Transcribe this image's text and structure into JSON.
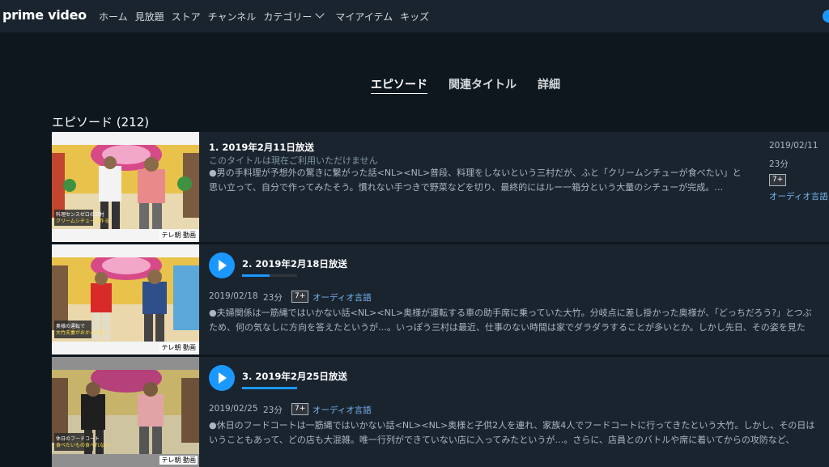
{
  "header": {
    "logo": "prime video",
    "nav": [
      "ホーム",
      "見放題",
      "ストア",
      "チャンネル",
      "カテゴリー",
      "マイアイテム",
      "キッズ"
    ]
  },
  "tabs": [
    "エピソード",
    "関連タイトル",
    "詳細"
  ],
  "section_title": "エピソード (212)",
  "episodes": [
    {
      "title": "1. 2019年2月11日放送",
      "unavailable": "このタイトルは現在ご利用いただけません",
      "desc1": "●男の手料理が予想外の驚きに繋がった話<NL><NL>普段、料理をしないという三村だが、ふと「クリームシチューが食べたい」と",
      "desc2": "思い立って、自分で作ってみたそう。慣れない手つきで野菜などを切り、最終的にはルー一箱分という大量のシチューが完成。…",
      "date": "2019/02/11",
      "duration": "23分",
      "rating": "7+",
      "audio": "オーディオ言語",
      "thumb_caption": "料理センスゼロの三村 クリームシチューを作る",
      "thumb_badge": "テレ朝 動画"
    },
    {
      "title": "2. 2019年2月18日放送",
      "progress": 0.5,
      "date": "2019/02/18",
      "duration": "23分",
      "rating": "7+",
      "audio": "オーディオ言語",
      "desc1": "●夫婦関係は一筋縄ではいかない話<NL><NL>奥様が運転する車の助手席に乗っていた大竹。分岐点に差し掛かった奥様が、「どっちだろう?」とつぶ",
      "desc2": "ため、何の気なしに方向を答えたというが…。いっぽう三村は最近、仕事のない時間は家でダラダラすることが多いとか。しかし先日、その姿を見た",
      "thumb_caption": "奥様の運転で 大竹夫妻がおかんむり!",
      "thumb_badge": "テレ朝 動画"
    },
    {
      "title": "3. 2019年2月25日放送",
      "progress": 1.0,
      "date": "2019/02/25",
      "duration": "23分",
      "rating": "7+",
      "audio": "オーディオ言語",
      "desc1": "●休日のフードコートは一筋縄ではいかない話<NL><NL>奥様と子供2人を連れ、家族4人でフードコートに行ってきたという大竹。しかし、その日は",
      "desc2": "いうこともあって、どの店も大混雑。唯一行列ができていない店に入ってみたというが…。さらに、店員とのバトルや席に着いてからの攻防など、",
      "thumb_caption": "休日のフードコート 食べたいもの食べれない",
      "thumb_badge": "テレ朝 動画"
    }
  ]
}
